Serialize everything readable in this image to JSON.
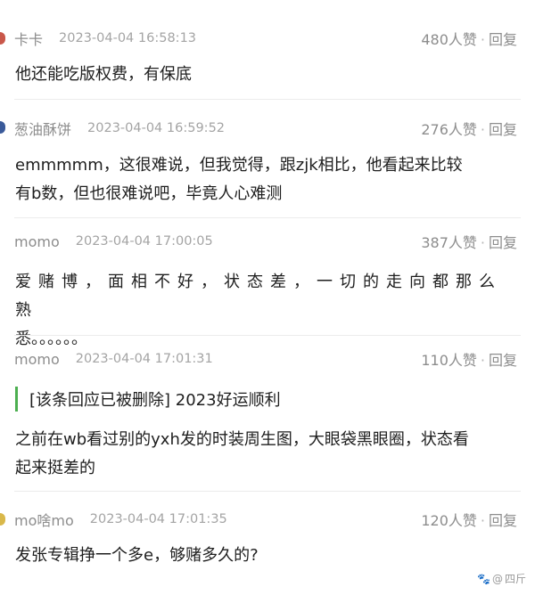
{
  "comments": [
    {
      "username": "卡卡",
      "timestamp": "2023-04-04 16:58:13",
      "likes": "480人赞",
      "reply_label": "回复",
      "lines": [
        "他还能吃版权费，有保底"
      ],
      "avatar_color": "#c9574a"
    },
    {
      "username": "葱油酥饼",
      "timestamp": "2023-04-04 16:59:52",
      "likes": "276人赞",
      "reply_label": "回复",
      "lines": [
        "emmmmm，这很难说，但我觉得，跟zjk相比，他看起来比较",
        "有b数，但也很难说吧，毕竟人心难测"
      ],
      "avatar_color": "#3a5a9a"
    },
    {
      "username": "momo",
      "timestamp": "2023-04-04 17:00:05",
      "likes": "387人赞",
      "reply_label": "回复",
      "lines": [
        "爱赌博，面相不好，状态差，一切的走向都那么熟",
        "悉。。。。。。"
      ]
    },
    {
      "username": "momo",
      "timestamp": "2023-04-04 17:01:31",
      "likes": "110人赞",
      "reply_label": "回复",
      "quote": "[该条回应已被删除] 2023好运顺利",
      "lines": [
        "之前在wb看过别的yxh发的时装周生图，大眼袋黑眼圈，状态看",
        "起来挺差的"
      ]
    },
    {
      "username": "mo啥mo",
      "timestamp": "2023-04-04 17:01:35",
      "likes": "120人赞",
      "reply_label": "回复",
      "lines": [
        "发张专辑挣一个多e，够赌多久的?"
      ],
      "avatar_color": "#d9b84a"
    }
  ],
  "watermark": {
    "icon": "paw-icon",
    "text": "四斤"
  }
}
